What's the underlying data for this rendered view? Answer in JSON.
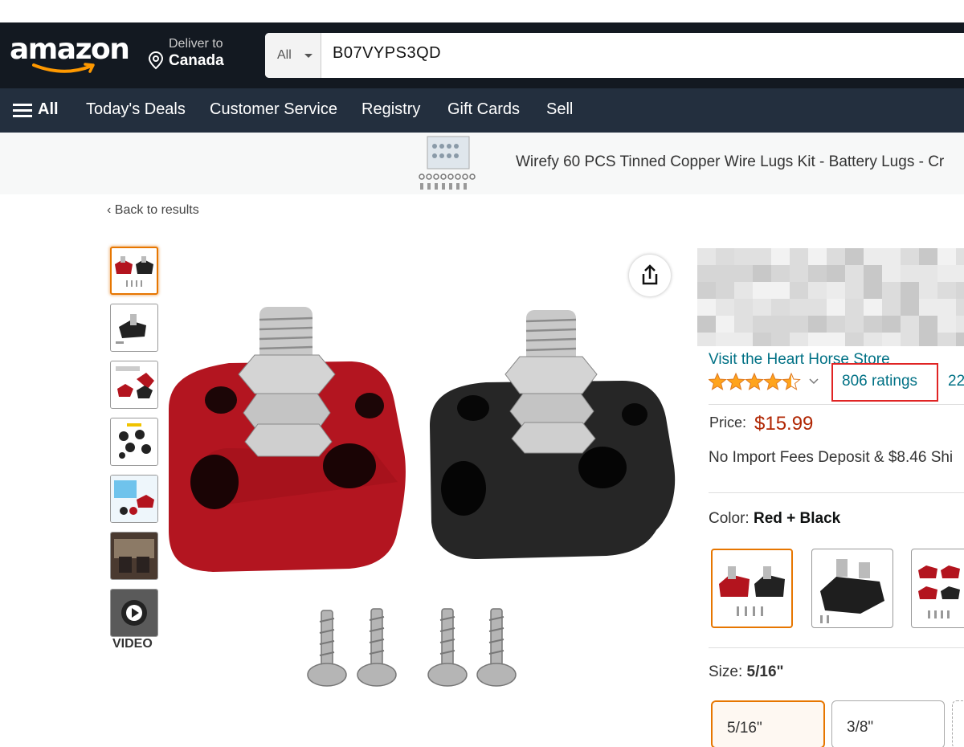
{
  "header": {
    "logo_text": "amazon",
    "deliver_line1": "Deliver to",
    "deliver_line2": "Canada",
    "search_category": "All",
    "search_query": "B07VYPS3QD"
  },
  "nav": {
    "all_label": "All",
    "items": [
      "Today's Deals",
      "Customer Service",
      "Registry",
      "Gift Cards",
      "Sell"
    ]
  },
  "promo": {
    "text": "Wirefy 60 PCS Tinned Copper Wire Lugs Kit - Battery Lugs - Cr"
  },
  "back_link": "‹ Back to results",
  "gallery": {
    "thumbnail_count": 7,
    "selected_index": 0,
    "video_label": "VIDEO"
  },
  "product": {
    "store_link": "Visit the Heart Horse Store",
    "rating_stars": 4.5,
    "ratings_text": "806 ratings",
    "answered_text": "22",
    "price_label": "Price:",
    "price": "$15.99",
    "shipping": "No Import Fees Deposit & $8.46 Shi",
    "color_label": "Color:",
    "color_value": "Red + Black",
    "size_label": "Size:",
    "size_value": "5/16\"",
    "sizes": [
      "5/16\"",
      "3/8\""
    ]
  },
  "colors": {
    "header_bg": "#131921",
    "nav_bg": "#232f3e",
    "link": "#007185",
    "price": "#b12704",
    "star": "#ffa41c",
    "highlight_box": "#e02424",
    "selection": "#e77600"
  }
}
